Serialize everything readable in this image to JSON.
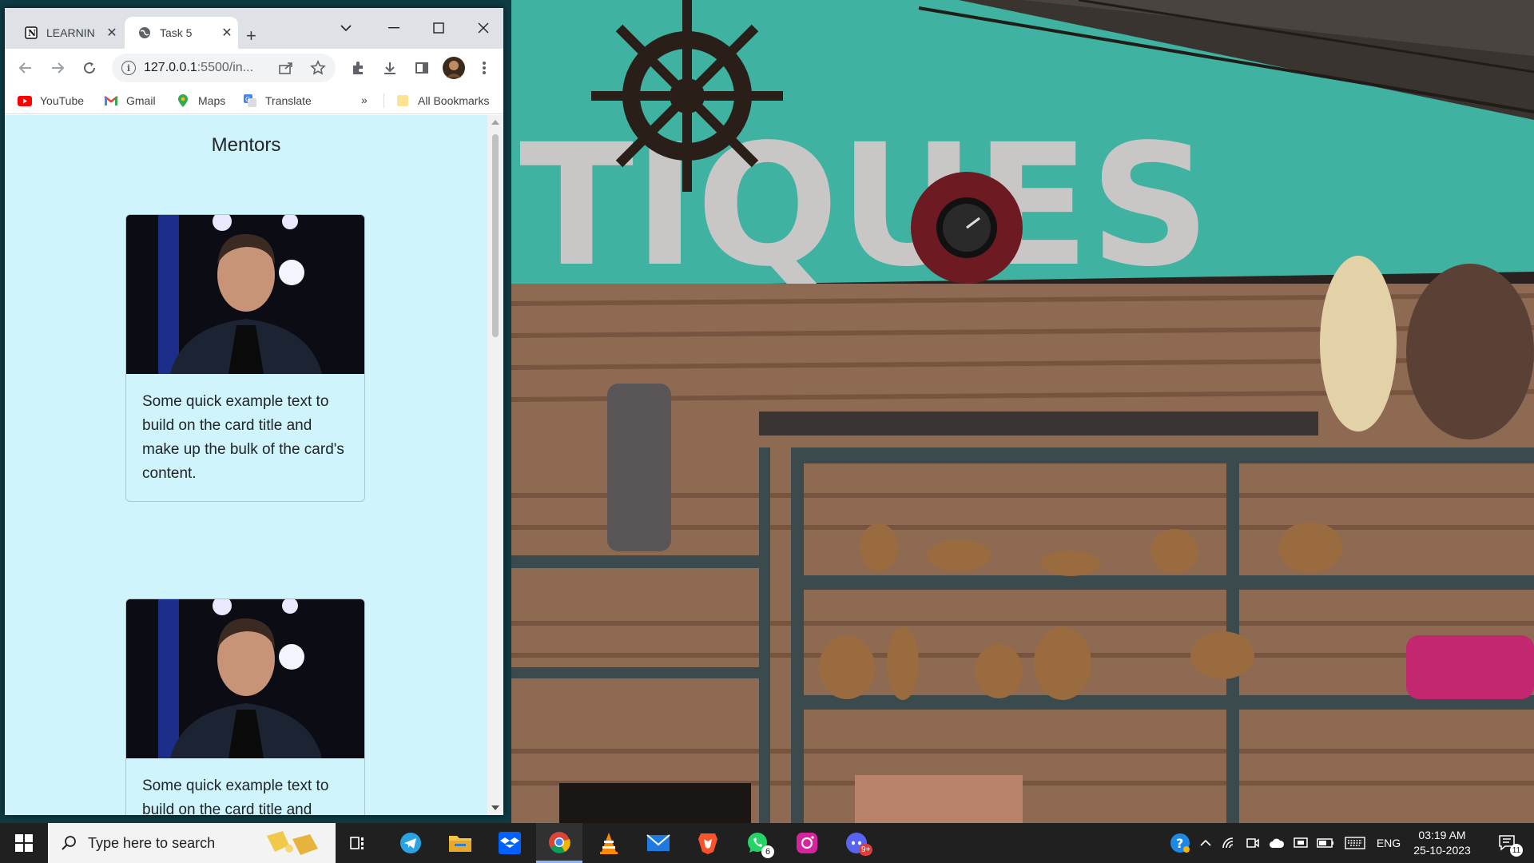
{
  "browser": {
    "tabs": [
      {
        "label": "LEARNIN",
        "icon": "notion-icon"
      },
      {
        "label": "Task 5",
        "icon": "globe-icon",
        "active": true
      }
    ],
    "url_host": "127.0.0.1",
    "url_rest": ":5500/in...",
    "bookmarks": [
      {
        "label": "YouTube",
        "icon": "youtube-icon"
      },
      {
        "label": "Gmail",
        "icon": "gmail-icon"
      },
      {
        "label": "Maps",
        "icon": "maps-icon"
      },
      {
        "label": "Translate",
        "icon": "translate-icon"
      }
    ],
    "bookmarks_overflow": "»",
    "all_bookmarks": "All Bookmarks"
  },
  "page": {
    "title": "Mentors",
    "cards": [
      {
        "text": "Some quick example text to build on the card title and make up the bulk of the card's content."
      },
      {
        "text": "Some quick example text to build on the card title and make up the bulk of the card's content."
      }
    ]
  },
  "wallpaper": {
    "sign_text": "TIQUES"
  },
  "taskbar": {
    "search_placeholder": "Type here to search",
    "whatsapp_badge": "6",
    "discord_badge": "9+",
    "language": "ENG",
    "time": "03:19 AM",
    "date": "25-10-2023",
    "notifications_count": "11"
  },
  "colors": {
    "page_bg": "#cff4fc",
    "tabstrip": "#dee1e6",
    "taskbar": "#202020"
  }
}
